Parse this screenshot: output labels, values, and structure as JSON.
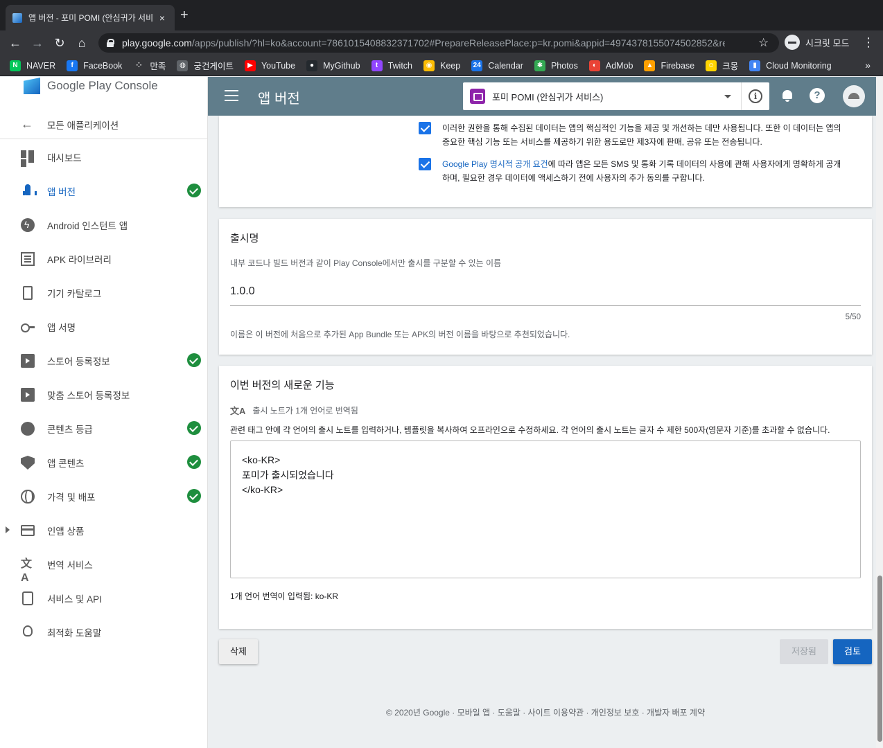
{
  "browser": {
    "tab_title": "앱 버전 - 포미 POMI (안심귀가 서비스",
    "tab_close": "×",
    "new_tab": "+",
    "url_host": "play.google.com",
    "url_rest": "/apps/publish/?hl=ko&account=7861015408832371702#PrepareReleasePlace:p=kr.pomi&appid=4974378155074502852&rel...",
    "incognito_label": "시크릿 모드",
    "bookmarks": [
      {
        "label": "NAVER",
        "icon": "naver-icon",
        "color": "#03c75a",
        "glyph": "N"
      },
      {
        "label": "FaceBook",
        "icon": "facebook-icon",
        "color": "#1877f2",
        "glyph": "f"
      },
      {
        "label": "만족",
        "icon": "dots-icon",
        "color": "#35363a",
        "glyph": "⁘"
      },
      {
        "label": "궁건게이트",
        "icon": "globe-icon",
        "color": "#5f6368",
        "glyph": "◍"
      },
      {
        "label": "YouTube",
        "icon": "youtube-icon",
        "color": "#ff0000",
        "glyph": "▶"
      },
      {
        "label": "MyGithub",
        "icon": "github-icon",
        "color": "#24292e",
        "glyph": "●"
      },
      {
        "label": "Twitch",
        "icon": "twitch-icon",
        "color": "#9146ff",
        "glyph": "t"
      },
      {
        "label": "Keep",
        "icon": "keep-icon",
        "color": "#fbbc04",
        "glyph": "◉"
      },
      {
        "label": "Calendar",
        "icon": "calendar-icon",
        "color": "#1a73e8",
        "glyph": "24"
      },
      {
        "label": "Photos",
        "icon": "photos-icon",
        "color": "#34a853",
        "glyph": "✱"
      },
      {
        "label": "AdMob",
        "icon": "admob-icon",
        "color": "#ea4335",
        "glyph": "◐"
      },
      {
        "label": "Firebase",
        "icon": "firebase-icon",
        "color": "#ffa000",
        "glyph": "▲"
      },
      {
        "label": "크몽",
        "icon": "kmong-icon",
        "color": "#ffd400",
        "glyph": "☺"
      },
      {
        "label": "Cloud Monitoring",
        "icon": "monitoring-icon",
        "color": "#4285f4",
        "glyph": "▮"
      }
    ],
    "bookmarks_more": "»"
  },
  "header": {
    "title": "앱 버전",
    "app_name": "포미 POMI (안심귀가 서비스)",
    "info_glyph": "i",
    "help_glyph": "?"
  },
  "sidebar": {
    "brand": "Google Play Console",
    "back_label": "모든 애플리케이션",
    "items": [
      {
        "label": "대시보드",
        "icon": "dashboard-icon",
        "done": false,
        "active": false
      },
      {
        "label": "앱 버전",
        "icon": "rocket-icon",
        "done": true,
        "active": true
      },
      {
        "label": "Android 인스턴트 앱",
        "icon": "bolt-icon",
        "done": false,
        "active": false
      },
      {
        "label": "APK 라이브러리",
        "icon": "apk-library-icon",
        "done": false,
        "active": false
      },
      {
        "label": "기기 카탈로그",
        "icon": "device-icon",
        "done": false,
        "active": false
      },
      {
        "label": "앱 서명",
        "icon": "key-icon",
        "done": false,
        "active": false
      },
      {
        "label": "스토어 등록정보",
        "icon": "store-icon",
        "done": true,
        "active": false
      },
      {
        "label": "맞춤 스토어 등록정보",
        "icon": "custom-store-icon",
        "done": false,
        "active": false
      },
      {
        "label": "콘텐츠 등급",
        "icon": "rating-icon",
        "done": true,
        "active": false
      },
      {
        "label": "앱 콘텐츠",
        "icon": "shield-icon",
        "done": true,
        "active": false
      },
      {
        "label": "가격 및 배포",
        "icon": "globe-icon",
        "done": true,
        "active": false
      },
      {
        "label": "인앱 상품",
        "icon": "card-icon",
        "done": false,
        "active": false
      },
      {
        "label": "번역 서비스",
        "icon": "translate-icon",
        "done": false,
        "active": false
      },
      {
        "label": "서비스 및 API",
        "icon": "api-icon",
        "done": false,
        "active": false
      },
      {
        "label": "최적화 도움말",
        "icon": "bulb-icon",
        "done": false,
        "active": false
      }
    ]
  },
  "permissions": {
    "item1": "이러한 권한을 통해 수집된 데이터는 앱의 핵심적인 기능을 제공 및 개선하는 데만 사용됩니다. 또한 이 데이터는 앱의 중요한 핵심 기능 또는 서비스를 제공하기 위한 용도로만 제3자에 판매, 공유 또는 전송됩니다.",
    "item2_link": "Google Play 명시적 공개 요건",
    "item2_rest": "에 따라 앱은 모든 SMS 및 통화 기록 데이터의 사용에 관해 사용자에게 명확하게 공개하며, 필요한 경우 데이터에 액세스하기 전에 사용자의 추가 동의를 구합니다."
  },
  "release_name": {
    "title": "출시명",
    "subtitle": "내부 코드나 빌드 버전과 같이 Play Console에서만 출시를 구분할 수 있는 이름",
    "value": "1.0.0",
    "counter": "5/50",
    "hint": "이름은 이 버전에 처음으로 추가된 App Bundle 또는 APK의 버전 이름을 바탕으로 추천되었습니다."
  },
  "whats_new": {
    "title": "이번 버전의 새로운 기능",
    "translation_status": "출시 노트가 1개 언어로 번역됨",
    "instructions": "관련 태그 안에 각 언어의 출시 노트를 입력하거나, 템플릿을 복사하여 오프라인으로 수정하세요. 각 언어의 출시 노트는 글자 수 제한 500자(영문자 기준)를 초과할 수 없습니다.",
    "notes": "<ko-KR>\n포미가 출시되었습니다\n</ko-KR>",
    "footer": "1개 언어 번역이 입력됨: ko-KR"
  },
  "actions": {
    "delete": "삭제",
    "saved": "저장됨",
    "review": "검토"
  },
  "footer": "© 2020년 Google · 모바일 앱 · 도움말 · 사이트 이용약관 · 개인정보 보호 · 개발자 배포 계약"
}
